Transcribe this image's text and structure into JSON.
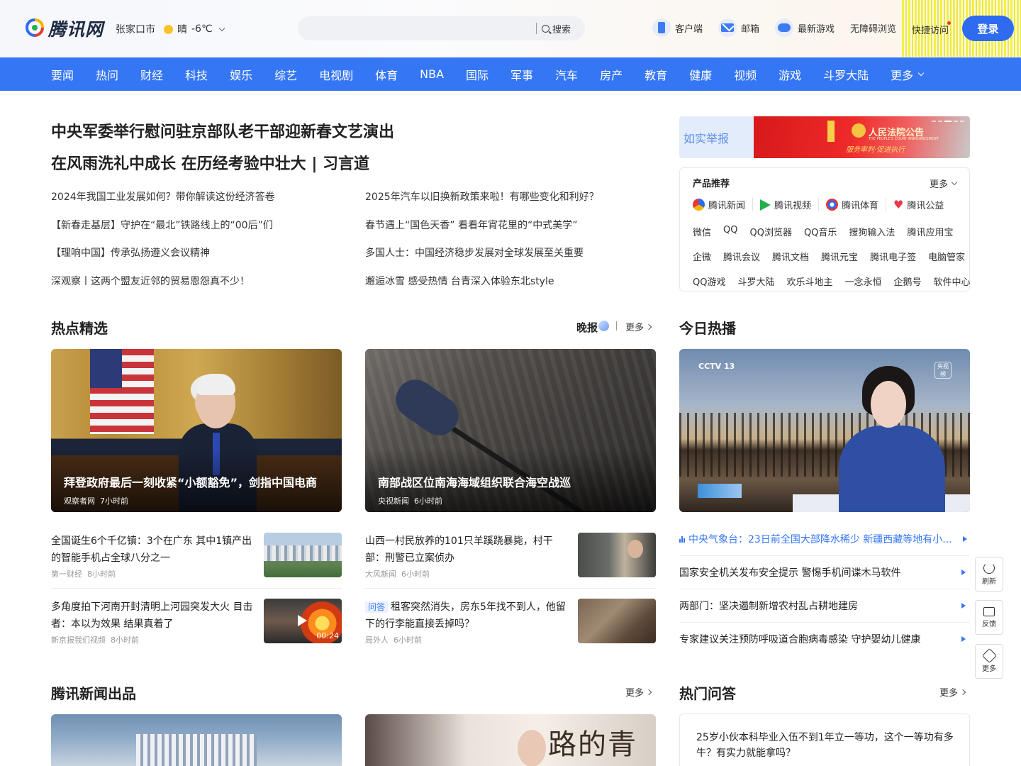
{
  "header": {
    "logo_text": "腾讯网",
    "city": "张家口市",
    "weather": "晴",
    "temperature": "-6℃",
    "search_placeholder": "",
    "search_label": "搜索",
    "tools": [
      {
        "label": "客户端",
        "icon": "phone-icon"
      },
      {
        "label": "邮箱",
        "icon": "mail-icon"
      },
      {
        "label": "最新游戏",
        "icon": "gamepad-icon"
      },
      {
        "label": "无障碍浏览"
      }
    ],
    "quick_access": "快捷访问",
    "login": "登录"
  },
  "nav": {
    "items": [
      "要闻",
      "热问",
      "财经",
      "科技",
      "娱乐",
      "综艺",
      "电视剧",
      "体育",
      "NBA",
      "国际",
      "军事",
      "汽车",
      "房产",
      "教育",
      "健康",
      "视频",
      "游戏",
      "斗罗大陆"
    ],
    "more": "更多"
  },
  "headlines": [
    "中央军委举行慰问驻京部队老干部迎新春文艺演出",
    "在风雨洗礼中成长 在历经考验中壮大 | 习言道"
  ],
  "news_left": [
    "2024年我国工业发展如何？带你解读这份经济答卷",
    "【新春走基层】守护在“最北”铁路线上的“00后”们",
    "【理响中国】传承弘扬遵义会议精神",
    "深观察丨这两个盟友近邻的贸易恩怨真不少！"
  ],
  "news_right": [
    "2025年汽车以旧换新政策来啦！有哪些变化和利好？",
    "春节遇上“国色天香” 看看年宵花里的“中式美学”",
    "多国人士：中国经济稳步发展对全球发展至关重要",
    "邂逅冰雪 感受热情 台青深入体验东北style"
  ],
  "banner": {
    "left_text": "如实举报",
    "right_title": "人民法院公告",
    "right_sub": "THE PEOPLE'S COURT ANNOUNCEMENT",
    "right_slogan": "服务审判·促进执行"
  },
  "products": {
    "title": "产品推荐",
    "more": "更多",
    "apps": [
      {
        "label": "腾讯新闻",
        "icon": "tencent-news-icon",
        "color": "#2e6bf1"
      },
      {
        "label": "腾讯视频",
        "icon": "tencent-video-icon",
        "color": "#21b04b"
      },
      {
        "label": "腾讯体育",
        "icon": "tencent-sports-icon",
        "color": "#e2342f"
      },
      {
        "label": "腾讯公益",
        "icon": "tencent-charity-icon",
        "color": "#e83a4a"
      }
    ],
    "row1": [
      "微信",
      "QQ",
      "QQ浏览器",
      "QQ音乐",
      "搜狗输入法",
      "腾讯应用宝"
    ],
    "row2": [
      "企微",
      "腾讯会议",
      "腾讯文档",
      "腾讯元宝",
      "腾讯电子签",
      "电脑管家"
    ],
    "row3": [
      "QQ游戏",
      "斗罗大陆",
      "欢乐斗地主",
      "一念永恒",
      "企鹅号",
      "软件中心"
    ]
  },
  "hot_picks": {
    "title": "热点精选",
    "wanbao": "晚报",
    "more": "更多",
    "cards": [
      {
        "title": "拜登政府最后一刻收紧“小额豁免”，剑指中国电商",
        "source": "观察者网",
        "time": "7小时前"
      },
      {
        "title": "南部战区位南海海域组织联合海空战巡",
        "source": "央视新闻",
        "time": "6小时前"
      }
    ],
    "items": [
      {
        "text": "全国诞生6个千亿镇：3个在广东 其中1镇产出的智能手机占全球八分之一",
        "source": "第一财经",
        "time": "8小时前"
      },
      {
        "text": "山西一村民放养的101只羊蹊跷暴毙，村干部：刑警已立案侦办",
        "source": "大风新闻",
        "time": "6小时前"
      },
      {
        "text": "多角度拍下河南开封清明上河园突发大火 目击者：本以为效果 结果真着了",
        "source": "新京报我们视频",
        "time": "8小时前",
        "duration": "00:24"
      },
      {
        "tag": "问答",
        "text": "租客突然消失，房东5年找不到人，他留下的行李能直接丢掉吗？",
        "source": "局外人",
        "time": "6小时前"
      }
    ]
  },
  "today_hot": {
    "title": "今日热播",
    "video_logo": "CCTV 13",
    "video_logo_sub": "央视频",
    "first": "中央气象台：23日前全国大部降水稀少 新疆西藏等地有小...",
    "items": [
      "国家安全机关发布安全提示 警惕手机间谍木马软件",
      "两部门：坚决遏制新增农村乱占耕地建房",
      "专家建议关注预防呼吸道合胞病毒感染 守护婴幼儿健康"
    ]
  },
  "side": {
    "refresh": "刷新",
    "feedback": "反馈",
    "more": "更多"
  },
  "tencent_news": {
    "title": "腾讯新闻出品",
    "more": "更多"
  },
  "hot_qa": {
    "title": "热门问答",
    "more": "更多",
    "first": "25岁小伙本科毕业入伍不到1年立一等功，这个一等功有多牛？有实力就能拿吗？"
  },
  "bottom_show_text": "路的青村"
}
